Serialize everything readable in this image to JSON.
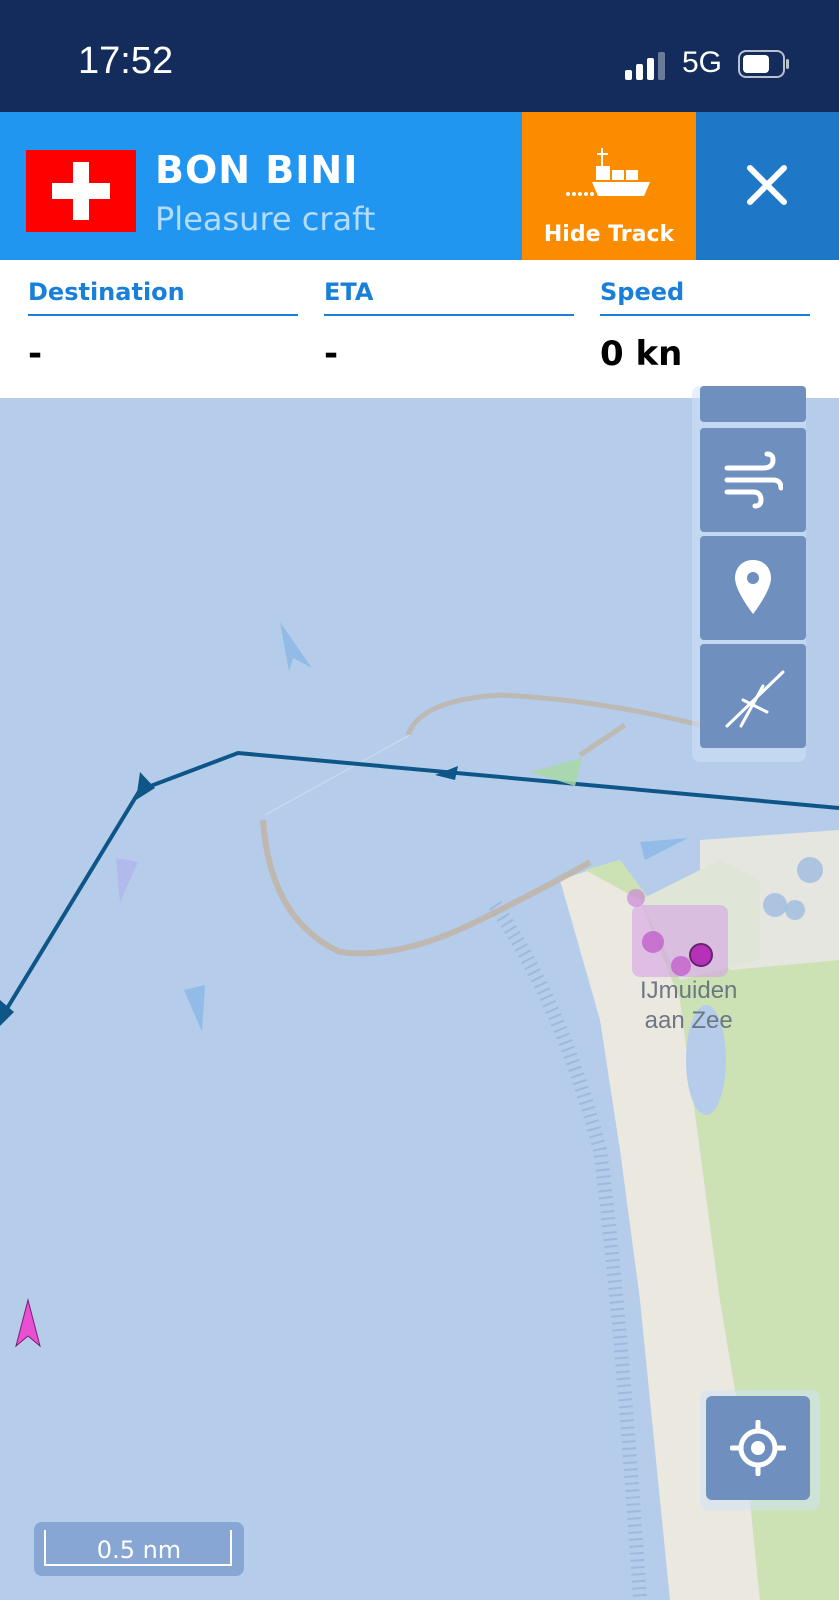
{
  "status_bar": {
    "time": "17:52",
    "network": "5G"
  },
  "vessel": {
    "name": "BON BINI",
    "type": "Pleasure craft",
    "flag_icon": "swiss-flag-icon",
    "hide_track_label": "Hide Track"
  },
  "info": {
    "destination": {
      "label": "Destination",
      "value": "-"
    },
    "eta": {
      "label": "ETA",
      "value": "-"
    },
    "speed": {
      "label": "Speed",
      "value": "0 kn"
    }
  },
  "map": {
    "town_line1": "IJmuiden",
    "town_line2": "aan Zee",
    "scale_label": "0.5 nm",
    "tools": [
      "wind-icon",
      "location-pin-icon",
      "measure-compass-icon"
    ],
    "track_color": "#0f5688"
  },
  "colors": {
    "header_blue": "#2196f0",
    "hide_track_orange": "#fb8c00",
    "close_blue": "#1f77c8",
    "status_navy": "#142c5c",
    "water": "#b5cdea",
    "land": "#cde2b4"
  }
}
